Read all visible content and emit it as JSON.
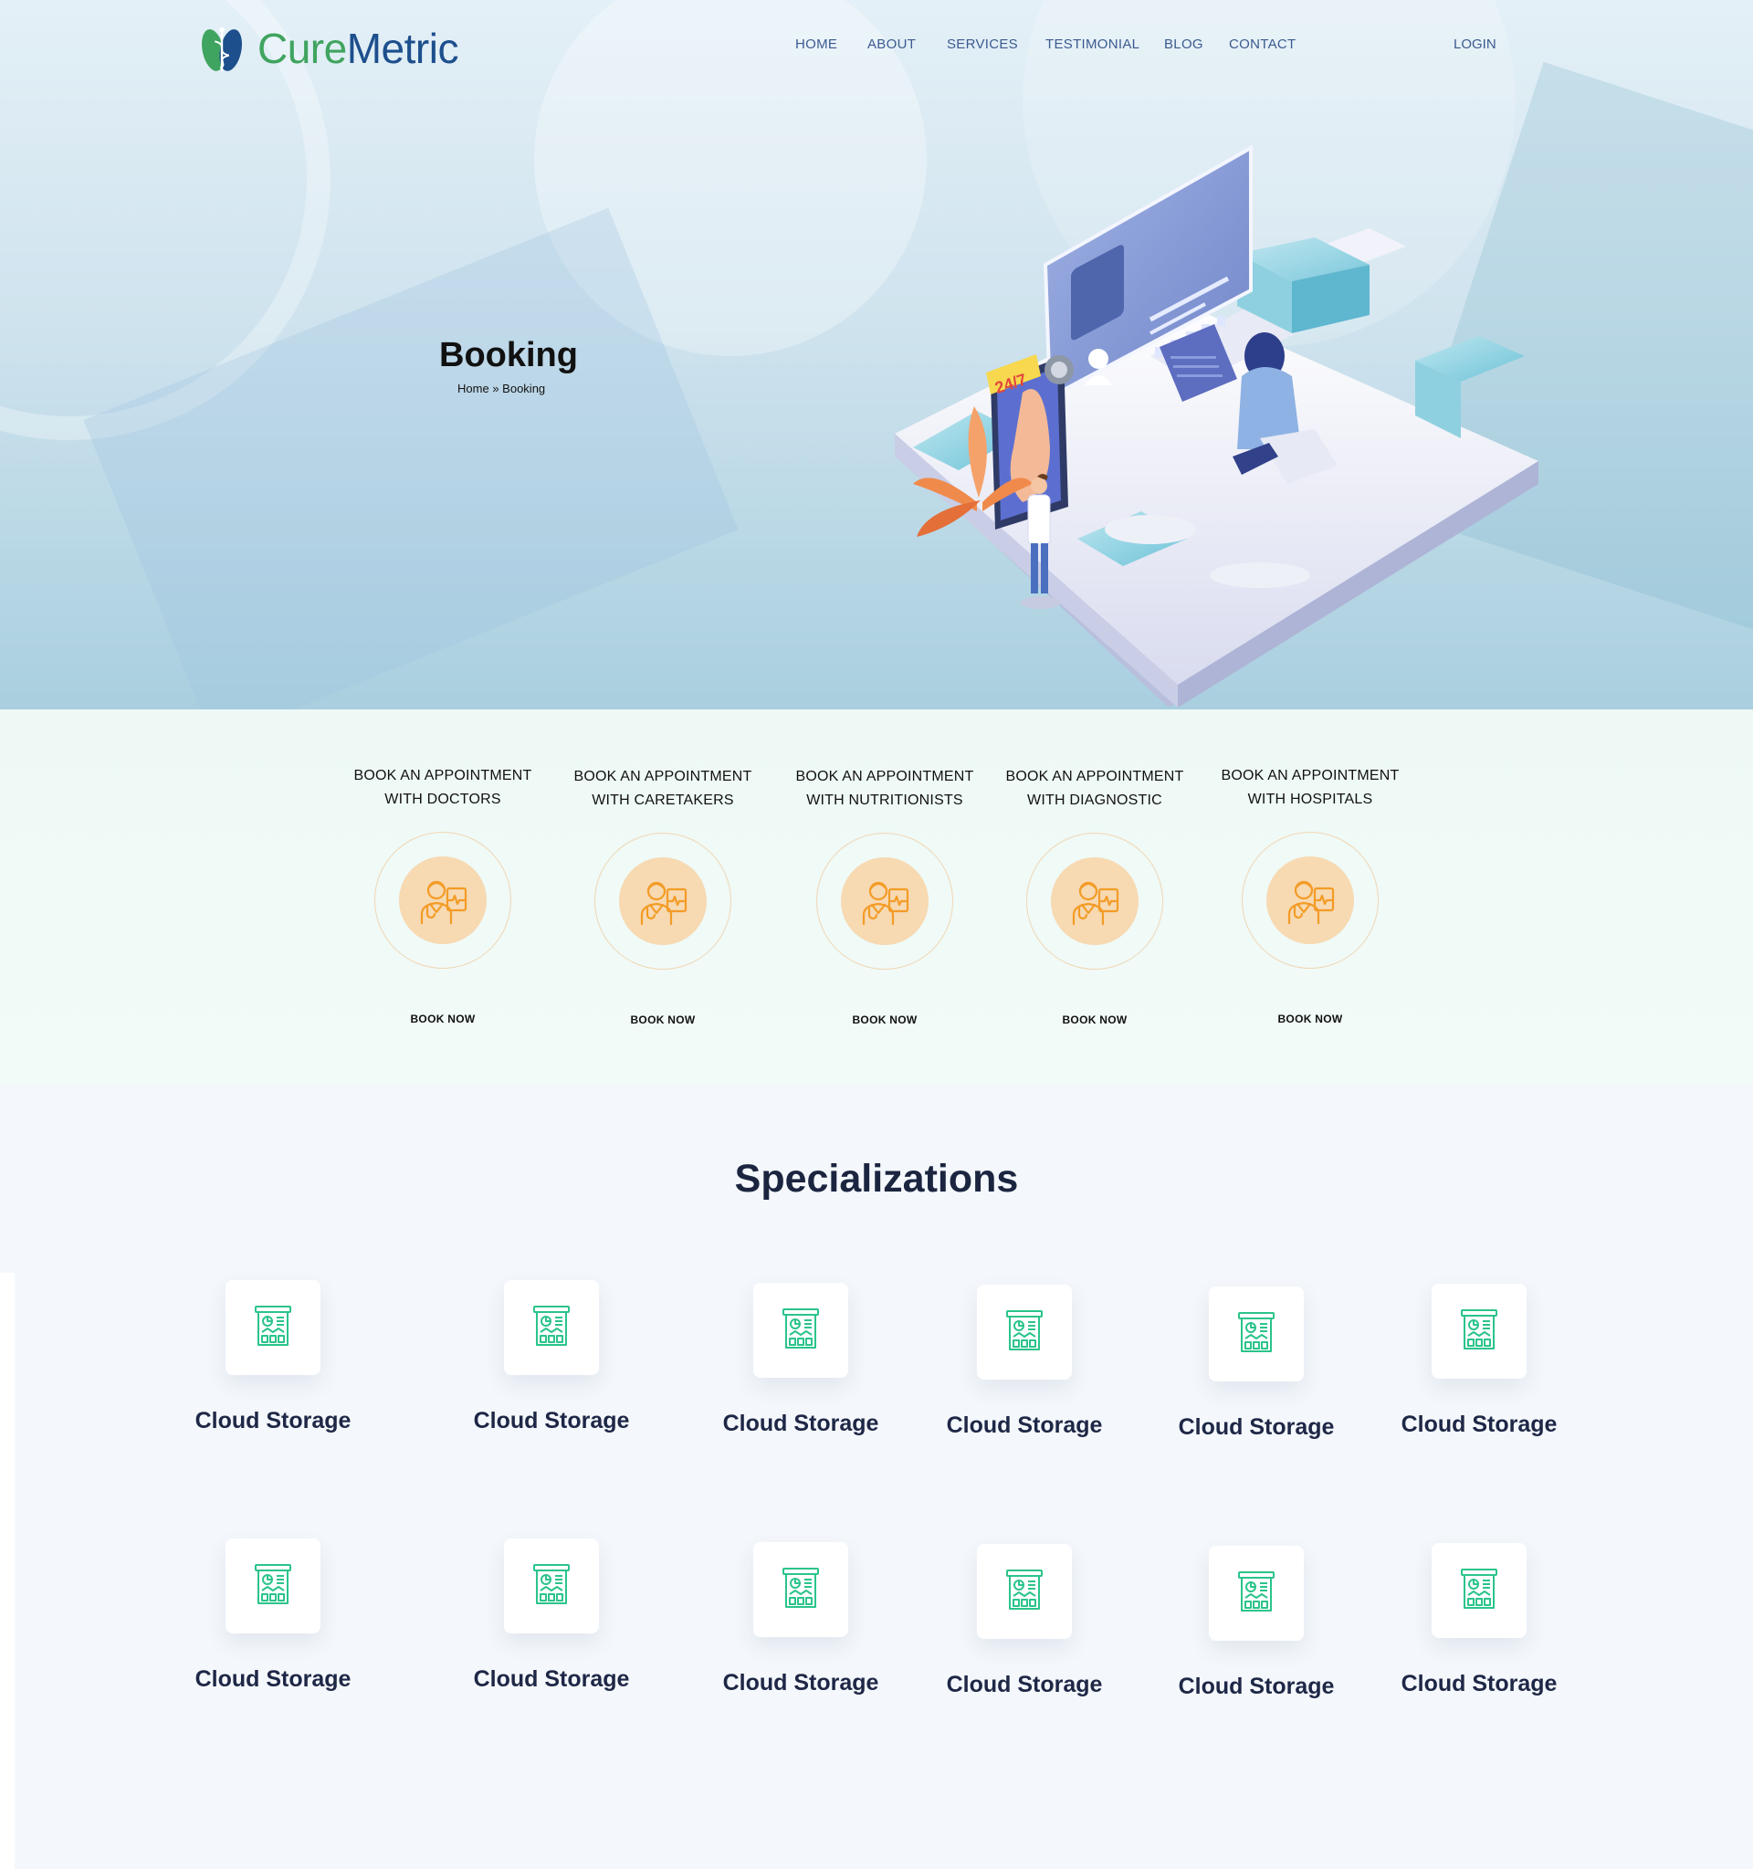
{
  "brand": {
    "name_part1": "Cure",
    "name_part2": "Metric",
    "color_green": "#3fa45f",
    "color_blue": "#1d4f8d"
  },
  "nav": {
    "items": [
      {
        "label": "HOME"
      },
      {
        "label": "ABOUT"
      },
      {
        "label": "SERVICES"
      },
      {
        "label": "TESTIMONIAL"
      },
      {
        "label": "BLOG"
      },
      {
        "label": "CONTACT"
      }
    ],
    "login": "LOGIN"
  },
  "hero": {
    "title": "Booking",
    "breadcrumb": {
      "home": "Home",
      "separator": "»",
      "current": "Booking"
    },
    "badge": "24/7"
  },
  "booking": {
    "cards": [
      {
        "line1": "BOOK AN APPOINTMENT",
        "line2": "WITH DOCTORS",
        "button": "BOOK NOW",
        "icon": "doctor-icon"
      },
      {
        "line1": "BOOK AN APPOINTMENT",
        "line2": "WITH  CARETAKERS",
        "button": "BOOK NOW",
        "icon": "doctor-icon"
      },
      {
        "line1": "BOOK AN APPOINTMENT",
        "line2": "WITH  NUTRITIONISTS",
        "button": "BOOK NOW",
        "icon": "doctor-icon"
      },
      {
        "line1": "BOOK AN APPOINTMENT",
        "line2": "WITH  DIAGNOSTIC",
        "button": "BOOK NOW",
        "icon": "doctor-icon"
      },
      {
        "line1": "BOOK AN APPOINTMENT",
        "line2": "WITH  HOSPITALS",
        "button": "BOOK NOW",
        "icon": "doctor-icon"
      }
    ],
    "accent": "#f7d9b2",
    "icon_color": "#f39c26"
  },
  "specializations": {
    "title": "Specializations",
    "icon": "dashboard-report-icon",
    "icon_color": "#2bc48a",
    "items": [
      {
        "label": "Cloud Storage"
      },
      {
        "label": "Cloud Storage"
      },
      {
        "label": "Cloud Storage"
      },
      {
        "label": "Cloud Storage"
      },
      {
        "label": "Cloud Storage"
      },
      {
        "label": "Cloud Storage"
      },
      {
        "label": "Cloud Storage"
      },
      {
        "label": "Cloud Storage"
      },
      {
        "label": "Cloud Storage"
      },
      {
        "label": "Cloud Storage"
      },
      {
        "label": "Cloud Storage"
      },
      {
        "label": "Cloud Storage"
      }
    ]
  }
}
